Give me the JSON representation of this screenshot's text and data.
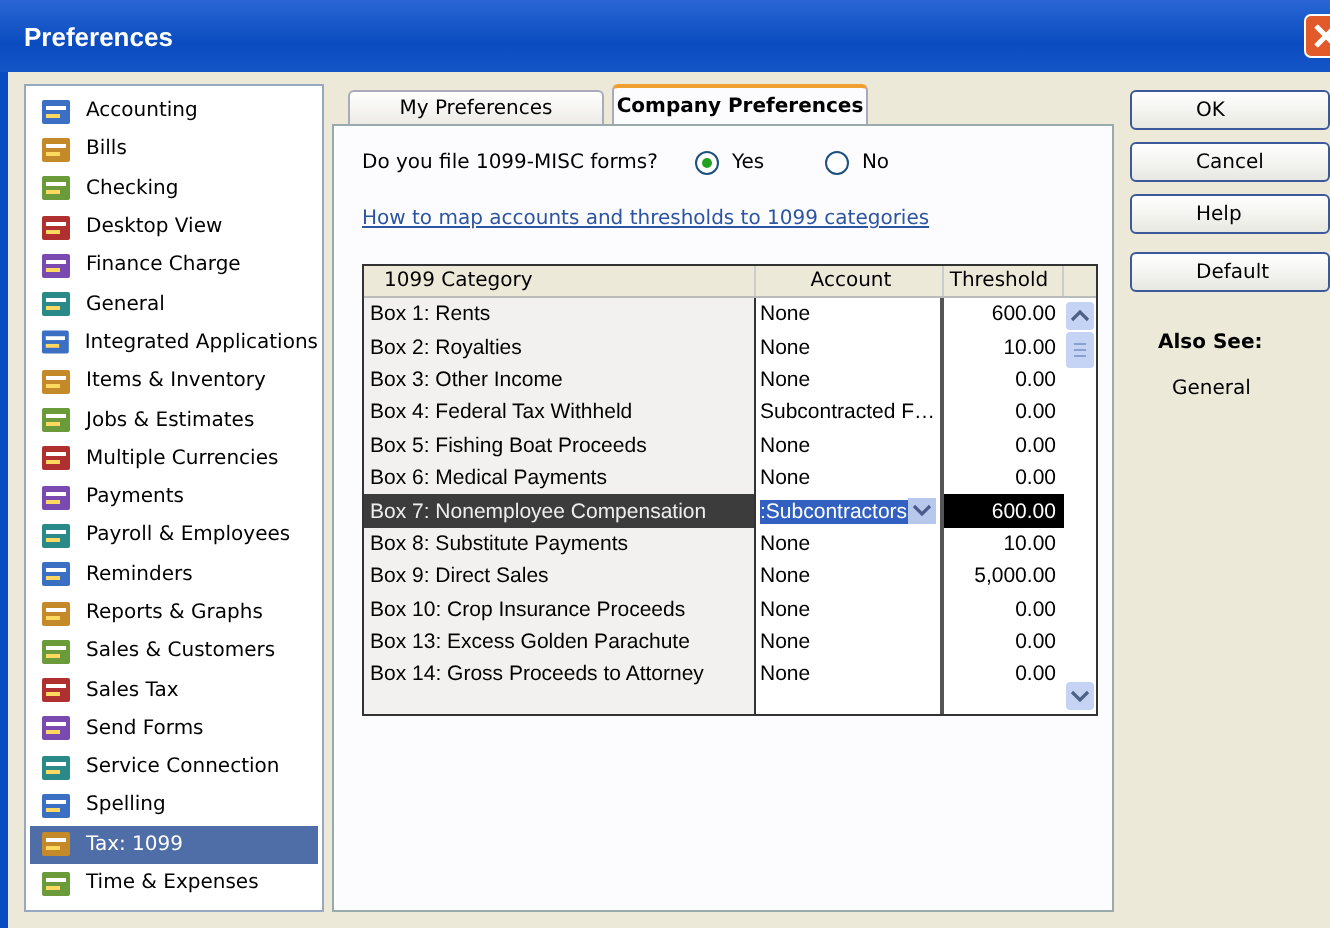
{
  "window": {
    "title": "Preferences"
  },
  "sidebar": {
    "items": [
      {
        "label": "Accounting",
        "selected": false
      },
      {
        "label": "Bills",
        "selected": false
      },
      {
        "label": "Checking",
        "selected": false
      },
      {
        "label": "Desktop View",
        "selected": false
      },
      {
        "label": "Finance Charge",
        "selected": false
      },
      {
        "label": "General",
        "selected": false
      },
      {
        "label": "Integrated Applications",
        "selected": false
      },
      {
        "label": "Items & Inventory",
        "selected": false
      },
      {
        "label": "Jobs & Estimates",
        "selected": false
      },
      {
        "label": "Multiple Currencies",
        "selected": false
      },
      {
        "label": "Payments",
        "selected": false
      },
      {
        "label": "Payroll & Employees",
        "selected": false
      },
      {
        "label": "Reminders",
        "selected": false
      },
      {
        "label": "Reports & Graphs",
        "selected": false
      },
      {
        "label": "Sales & Customers",
        "selected": false
      },
      {
        "label": "Sales Tax",
        "selected": false
      },
      {
        "label": "Send Forms",
        "selected": false
      },
      {
        "label": "Service Connection",
        "selected": false
      },
      {
        "label": "Spelling",
        "selected": false
      },
      {
        "label": "Tax: 1099",
        "selected": true
      },
      {
        "label": "Time & Expenses",
        "selected": false
      }
    ]
  },
  "tabs": [
    {
      "label": "My Preferences",
      "selected": false
    },
    {
      "label": "Company Preferences",
      "selected": true
    }
  ],
  "question": "Do you file 1099-MISC forms?",
  "options": [
    {
      "label": "Yes",
      "selected": true
    },
    {
      "label": "No",
      "selected": false
    }
  ],
  "help_link": "How to map accounts and thresholds to 1099 categories",
  "table": {
    "columns": [
      "1099 Category",
      "Account",
      "Threshold"
    ],
    "rows": [
      {
        "cells": [
          "Box 1: Rents",
          "None",
          "600.00"
        ],
        "selected": false
      },
      {
        "cells": [
          "Box 2: Royalties",
          "None",
          "10.00"
        ],
        "selected": false
      },
      {
        "cells": [
          "Box 3: Other Income",
          "None",
          "0.00"
        ],
        "selected": false
      },
      {
        "cells": [
          "Box 4: Federal Tax Withheld",
          "Subcontracted F…",
          "0.00"
        ],
        "selected": false
      },
      {
        "cells": [
          "Box 5: Fishing Boat Proceeds",
          "None",
          "0.00"
        ],
        "selected": false
      },
      {
        "cells": [
          "Box 6: Medical Payments",
          "None",
          "0.00"
        ],
        "selected": false
      },
      {
        "cells": [
          "Box 7: Nonemployee Compensation",
          ":Subcontractors",
          "600.00"
        ],
        "selected": true
      },
      {
        "cells": [
          "Box 8: Substitute Payments",
          "None",
          "10.00"
        ],
        "selected": false
      },
      {
        "cells": [
          "Box 9: Direct Sales",
          "None",
          "5,000.00"
        ],
        "selected": false
      },
      {
        "cells": [
          "Box 10: Crop Insurance Proceeds",
          "None",
          "0.00"
        ],
        "selected": false
      },
      {
        "cells": [
          "Box 13: Excess Golden Parachute",
          "None",
          "0.00"
        ],
        "selected": false
      },
      {
        "cells": [
          "Box 14: Gross Proceeds to Attorney",
          "None",
          "0.00"
        ],
        "selected": false
      }
    ]
  },
  "buttons": [
    "OK",
    "Cancel",
    "Help",
    "Default"
  ],
  "also_see": {
    "title": "Also See:",
    "links": [
      "General"
    ]
  }
}
